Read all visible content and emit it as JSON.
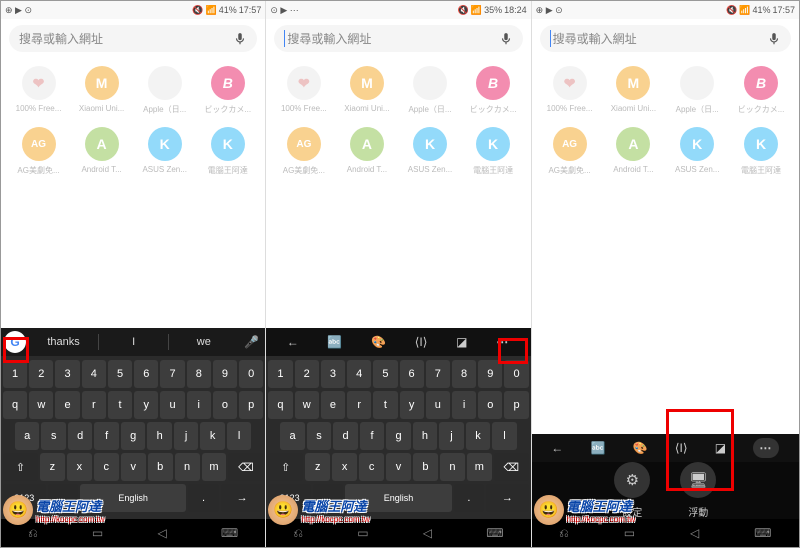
{
  "status": {
    "left_icons": "⊕ ▶ ⊙",
    "left_icons2": "⊙ ▶ ⋯",
    "mute": "🔇",
    "signal": "📶",
    "battery1": "41%",
    "battery2": "35%",
    "time1": "17:57",
    "time2": "18:24"
  },
  "search": {
    "placeholder": "搜尋或輸入網址"
  },
  "bookmarks": {
    "row1": [
      {
        "label": "100% Free...",
        "icon": "❤",
        "bg": "#e8e8e8"
      },
      {
        "label": "Xiaomi Uni...",
        "icon": "M",
        "bg": "#f5a623"
      },
      {
        "label": "Apple（日...",
        "icon": "",
        "bg": "#e8e8e8"
      },
      {
        "label": "ビックカメ...",
        "icon": "B",
        "bg": "#e91e63"
      }
    ],
    "row2": [
      {
        "label": "AG美劇免...",
        "icon": "AG",
        "bg": "#f5a623"
      },
      {
        "label": "Android T...",
        "icon": "A",
        "bg": "#8bc34a"
      },
      {
        "label": "ASUS Zen...",
        "icon": "K",
        "bg": "#29b6f6"
      },
      {
        "label": "電腦王阿達",
        "icon": "K",
        "bg": "#29b6f6"
      }
    ]
  },
  "keyboard": {
    "suggestions": [
      "thanks",
      "I",
      "we"
    ],
    "row_num": [
      "1",
      "2",
      "3",
      "4",
      "5",
      "6",
      "7",
      "8",
      "9",
      "0"
    ],
    "row_q": [
      "q",
      "w",
      "e",
      "r",
      "t",
      "y",
      "u",
      "i",
      "o",
      "p"
    ],
    "row_a": [
      "a",
      "s",
      "d",
      "f",
      "g",
      "h",
      "j",
      "k",
      "l"
    ],
    "row_z": [
      "z",
      "x",
      "c",
      "v",
      "b",
      "n",
      "m"
    ],
    "shift": "⇧",
    "backspace": "⌫",
    "sym": "?123",
    "comma": ",",
    "space": "English",
    "period": ".",
    "enter": "→",
    "mic": "🎤"
  },
  "tools": {
    "mic": "🎤",
    "back": "←",
    "translate": "🔤",
    "palette": "🎨",
    "cursor": "⟨I⟩",
    "sticker": "◪",
    "more": "⋯"
  },
  "settings": {
    "settings_label": "設定",
    "float_label": "浮動",
    "gear": "⚙",
    "screen": "🖥"
  },
  "nav": {
    "recent": "⎌",
    "home": "▭",
    "back": "◁",
    "kb": "⌨"
  },
  "watermark": {
    "title": "電腦王阿達",
    "url": "http://kocpc.com.tw"
  }
}
